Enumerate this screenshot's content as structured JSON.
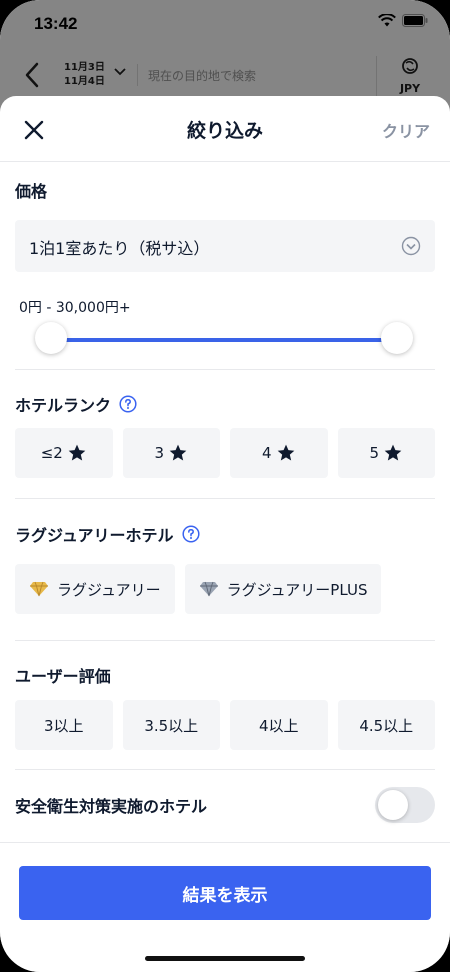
{
  "status_bar": {
    "time": "13:42"
  },
  "search_bar": {
    "checkin": "11月3日",
    "checkout": "11月4日",
    "placeholder": "現在の目的地で検索",
    "currency": "JPY"
  },
  "sheet": {
    "title": "絞り込み",
    "clear_label": "クリア"
  },
  "price": {
    "title": "価格",
    "mode_selected": "1泊1室あたり（税サ込）",
    "range_label": "0円 - 30,000円+",
    "range_min_fraction": 0,
    "range_max_fraction": 1
  },
  "hotel_rank": {
    "title": "ホテルランク",
    "options": [
      "≤2",
      "3",
      "4",
      "5"
    ]
  },
  "luxury": {
    "title": "ラグジュアリーホテル",
    "options": [
      {
        "label": "ラグジュアリー",
        "icon": "gold-diamond-icon"
      },
      {
        "label": "ラグジュアリーPLUS",
        "icon": "silver-diamond-icon"
      }
    ]
  },
  "user_rating": {
    "title": "ユーザー評価",
    "options": [
      "3以上",
      "3.5以上",
      "4以上",
      "4.5以上"
    ]
  },
  "safety": {
    "label": "安全衛生対策実施のホテル",
    "enabled": false
  },
  "footer": {
    "show_results_label": "結果を表示"
  },
  "colors": {
    "accent": "#3a63f0",
    "text": "#0f1a2e",
    "chip_bg": "#f4f5f7",
    "muted": "#8a93a3"
  }
}
